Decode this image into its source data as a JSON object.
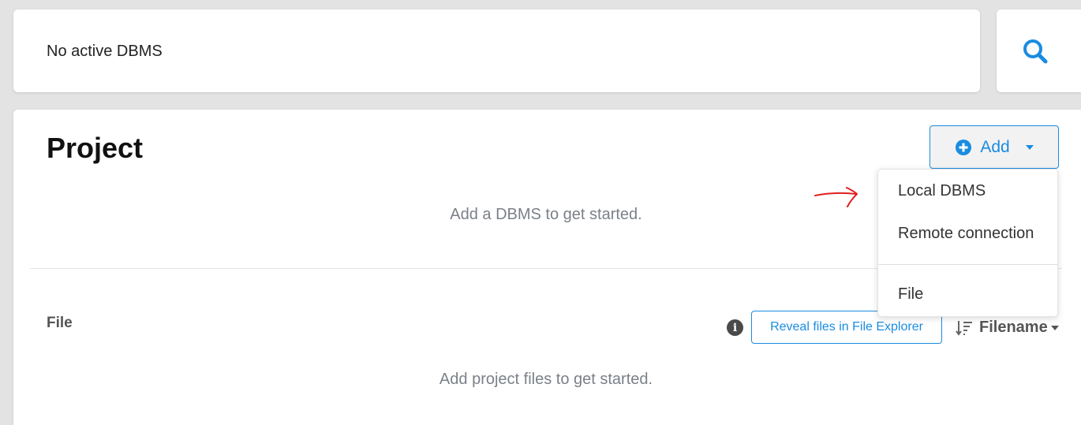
{
  "status_bar": {
    "text": "No active DBMS"
  },
  "search": {
    "icon": "search-icon"
  },
  "project": {
    "title": "Project",
    "add_button": {
      "label": "Add",
      "icon": "plus-circle-icon"
    },
    "empty_dbms_message": "Add a DBMS to get started."
  },
  "add_menu": {
    "items": [
      {
        "label": "Local DBMS"
      },
      {
        "label": "Remote connection"
      },
      {
        "label": "File"
      }
    ]
  },
  "files": {
    "heading": "File",
    "reveal_button": "Reveal files in File Explorer",
    "sort": {
      "label": "Filename",
      "icon": "sort-descending-icon"
    },
    "empty_message": "Add project files to get started."
  },
  "colors": {
    "accent": "#1a8ce0",
    "annotation": "#e02020",
    "muted_text": "#7b8088",
    "background": "#e3e3e3"
  }
}
